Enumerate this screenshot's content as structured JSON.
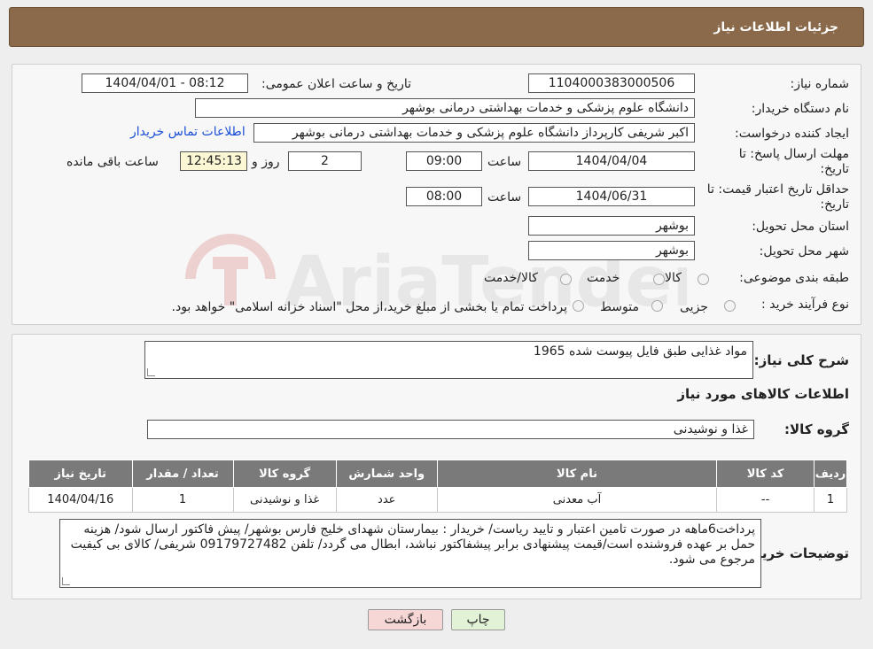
{
  "header": {
    "title": "جزئیات اطلاعات نیاز"
  },
  "form": {
    "need_number_label": "شماره نیاز:",
    "need_number": "1104000383000506",
    "announce_label": "تاریخ و ساعت اعلان عمومی:",
    "announce_value": "1404/04/01 - 08:12",
    "buyer_org_label": "نام دستگاه خریدار:",
    "buyer_org": "دانشگاه علوم پزشکی و خدمات بهداشتی درمانی بوشهر",
    "requester_label": "ایجاد کننده درخواست:",
    "requester": "اکبر شریفی کارپرداز دانشگاه علوم پزشکی و خدمات بهداشتی درمانی بوشهر",
    "contact_link": "اطلاعات تماس خریدار",
    "deadline_label": "مهلت ارسال پاسخ: تا تاریخ:",
    "deadline_date": "1404/04/04",
    "time_label": "ساعت",
    "deadline_time": "09:00",
    "days_value": "2",
    "days_label": "روز و",
    "remaining_time": "12:45:13",
    "remaining_label": "ساعت باقی مانده",
    "validity_label": "حداقل تاریخ اعتبار قیمت: تا تاریخ:",
    "validity_date": "1404/06/31",
    "validity_time": "08:00",
    "province_label": "استان محل تحویل:",
    "province": "بوشهر",
    "city_label": "شهر محل تحویل:",
    "city": "بوشهر",
    "category_label": "طبقه بندی موضوعی:",
    "category_options": [
      "کالا",
      "خدمت",
      "کالا/خدمت"
    ],
    "purchase_type_label": "نوع فرآیند خرید :",
    "purchase_options": [
      "جزیی",
      "متوسط"
    ],
    "purchase_note": "پرداخت تمام یا بخشی از مبلغ خرید،از محل \"اسناد خزانه اسلامی\" خواهد بود."
  },
  "summary": {
    "desc_label": "شرح کلی نیاز:",
    "desc_value": "مواد غذایی طبق فایل پیوست شده 1965",
    "items_title": "اطلاعات کالاهای مورد نیاز",
    "group_label": "گروه کالا:",
    "group_value": "غذا و نوشیدنی"
  },
  "table": {
    "headers": [
      "ردیف",
      "کد کالا",
      "نام کالا",
      "واحد شمارش",
      "گروه کالا",
      "تعداد / مقدار",
      "تاریخ نیاز"
    ],
    "rows": [
      [
        "1",
        "--",
        "آب معدنی",
        "عدد",
        "غذا و نوشیدنی",
        "1",
        "1404/04/16"
      ]
    ]
  },
  "notes": {
    "label": "توضیحات خریدار:",
    "text": "پرداخت6ماهه در صورت تامین اعتبار و تایید ریاست/ خریدار : بیمارستان شهدای خلیج فارس بوشهر/ پیش فاکتور ارسال شود/ هزینه حمل بر عهده فروشنده است/قیمت پیشنهادی برابر پیشفاکتور نباشد، ابطال می گردد/ تلفن 09179727482 شریفی/ کالای بی کیفیت مرجوع می شود."
  },
  "buttons": {
    "print": "چاپ",
    "back": "بازگشت"
  },
  "watermark": {
    "text": "AriaTender.neT"
  },
  "colors": {
    "header": "#8a6a4a",
    "table_header": "#7a7a7a",
    "highlight": "#fbf7d4",
    "back_button": "#f7d6d6",
    "print_button": "#e2f2d6"
  }
}
